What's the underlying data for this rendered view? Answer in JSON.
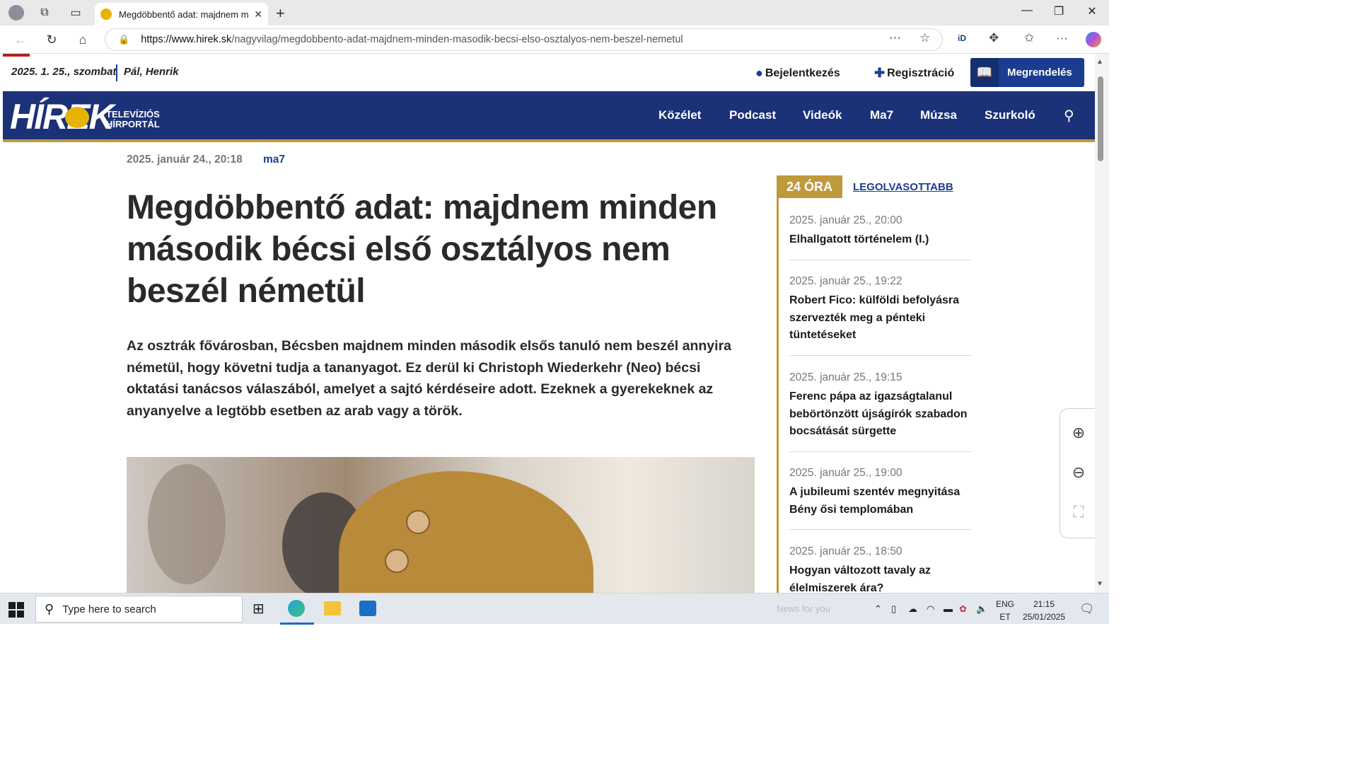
{
  "browser": {
    "tab_title": "Megdöbbentő adat: majdnem minden második bécsi első osztályos nem beszél németül",
    "tab_close": "✕",
    "new_tab": "+",
    "url_domain": "https://www.hirek.sk",
    "url_path": "/nagyvilag/megdobbento-adat-majdnem-minden-masodik-becsi-elso-osztalyos-nem-beszel-nemetul"
  },
  "site": {
    "date": "2025. 1. 25., szombat",
    "nameday": "Pál, Henrik",
    "login": "Bejelentkezés",
    "register": "Regisztráció",
    "order": "Megrendelés",
    "logo_text": "HÍREK",
    "logo_sub1": "TELEVÍZIÓS",
    "logo_sub2": "HÍRPORTÁL",
    "nav": [
      "Közélet",
      "Podcast",
      "Videók",
      "Ma7",
      "Múzsa",
      "Szurkoló"
    ]
  },
  "article": {
    "date": "2025. január 24., 20:18",
    "category": "ma7",
    "headline": "Megdöbbentő adat: majdnem minden második bécsi első osztályos nem beszél németül",
    "lead": "Az osztrák fővárosban, Bécsben majdnem minden második elsős tanuló nem beszél annyira németül, hogy követni tudja a tananyagot. Ez derül ki Christoph Wiederkehr (Neo) bécsi oktatási tanácsos válaszából, amelyet a sajtó kérdéseire adott. Ezeknek a gyerekeknek az anyanyelve a legtöbb esetben az arab vagy a török."
  },
  "sidebar": {
    "tab_active": "24 ÓRA",
    "tab_other": "LEGOLVASOTTABB",
    "items": [
      {
        "time": "2025. január 25., 20:00",
        "title": "Elhallgatott történelem (I.)"
      },
      {
        "time": "2025. január 25., 19:22",
        "title": "Robert Fico: külföldi befolyásra szervezték meg a pénteki tüntetéseket"
      },
      {
        "time": "2025. január 25., 19:15",
        "title": "Ferenc pápa az igazságtalanul bebörtönzött újságírók szabadon bocsátását sürgette"
      },
      {
        "time": "2025. január 25., 19:00",
        "title": "A jubileumi szentév megnyitása Bény ősi templomában"
      },
      {
        "time": "2025. január 25., 18:50",
        "title": "Hogyan változott tavaly az élelmiszerek ára?"
      }
    ]
  },
  "taskbar": {
    "search_placeholder": "Type here to search",
    "news": "News for you",
    "lang1": "ENG",
    "lang2": "ET",
    "time": "21:15",
    "date": "25/01/2025"
  },
  "colors": {
    "brand_blue": "#1b3278",
    "gold": "#bf9a3c"
  }
}
